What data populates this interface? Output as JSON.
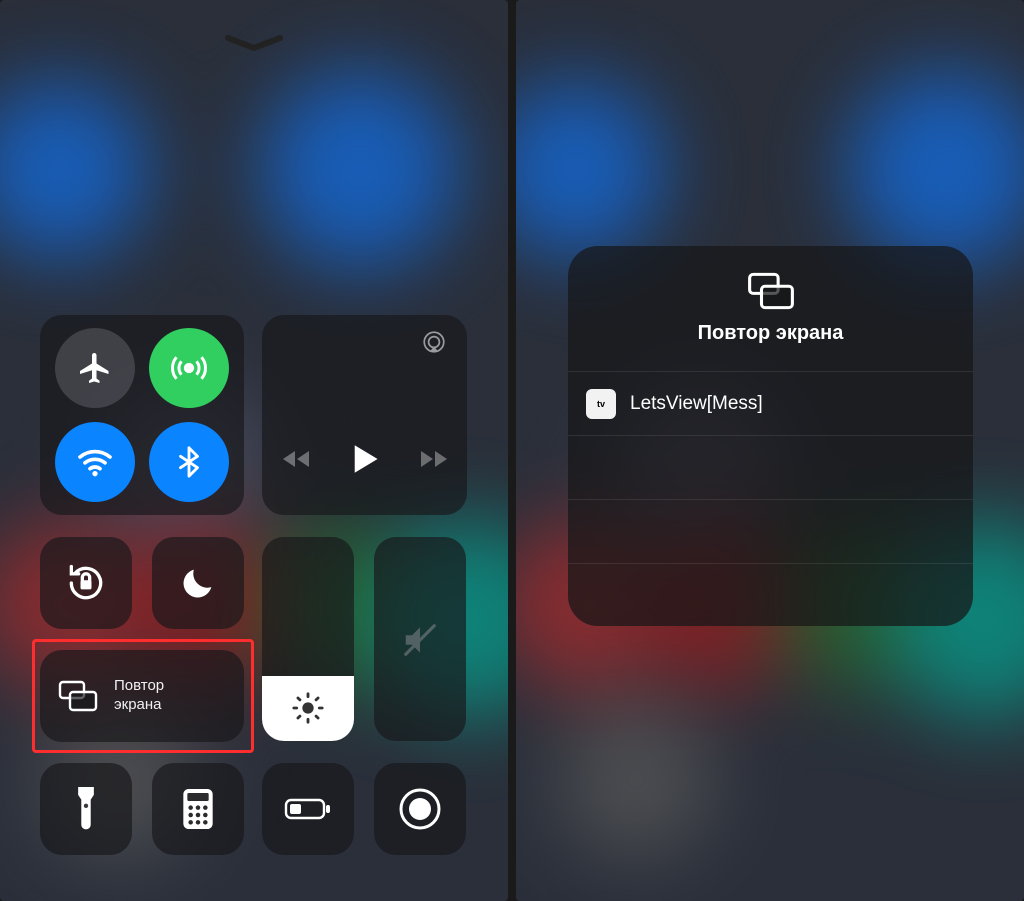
{
  "left": {
    "screen_mirror": {
      "line1": "Повтор",
      "line2": "экрана"
    },
    "brightness_pct": 32,
    "volume_pct": 0
  },
  "right": {
    "title": "Повтор экрана",
    "badge": "tv",
    "devices": [
      "LetsView[Mess]"
    ]
  }
}
